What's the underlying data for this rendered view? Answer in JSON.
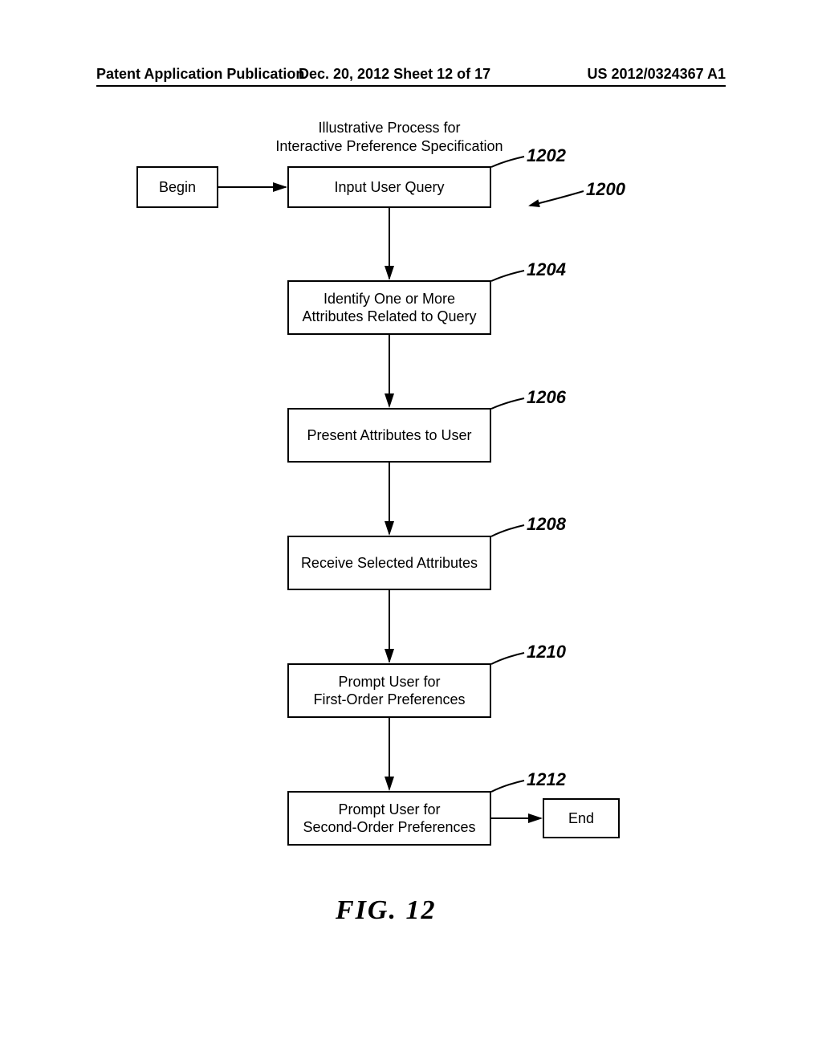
{
  "header": {
    "left": "Patent Application Publication",
    "mid": "Dec. 20, 2012  Sheet 12 of 17",
    "right": "US 2012/0324367 A1"
  },
  "diagram": {
    "title_line1": "Illustrative Process for",
    "title_line2": "Interactive Preference Specification",
    "begin": "Begin",
    "end": "End",
    "steps": {
      "s1202": "Input User Query",
      "s1204_l1": "Identify One or More",
      "s1204_l2": "Attributes Related to Query",
      "s1206": "Present Attributes to User",
      "s1208": "Receive Selected Attributes",
      "s1210_l1": "Prompt User for",
      "s1210_l2": "First-Order Preferences",
      "s1212_l1": "Prompt User for",
      "s1212_l2": "Second-Order Preferences"
    },
    "refs": {
      "r1200": "1200",
      "r1202": "1202",
      "r1204": "1204",
      "r1206": "1206",
      "r1208": "1208",
      "r1210": "1210",
      "r1212": "1212"
    },
    "figure_caption": "FIG.  12"
  }
}
